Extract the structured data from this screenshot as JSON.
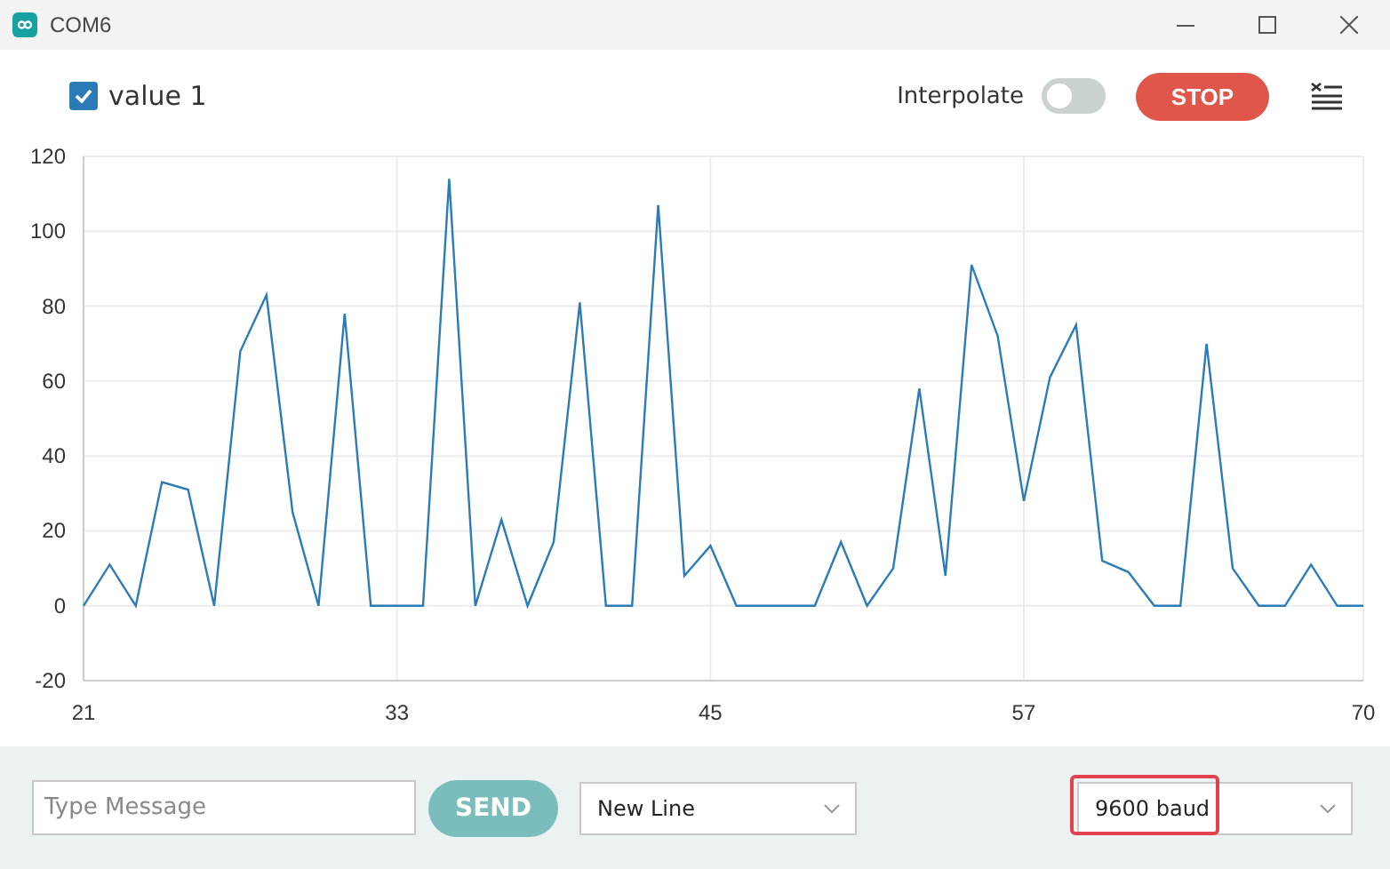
{
  "window": {
    "title": "COM6"
  },
  "toolbar": {
    "legend": [
      {
        "checked": true
      }
    ],
    "interpolate": {
      "label": "Interpolate",
      "on": false
    },
    "stop_button": "STOP"
  },
  "chart_data": {
    "type": "line",
    "x": [
      21,
      22,
      23,
      24,
      25,
      26,
      27,
      28,
      29,
      30,
      31,
      32,
      33,
      34,
      35,
      36,
      37,
      38,
      39,
      40,
      41,
      42,
      43,
      44,
      45,
      46,
      47,
      48,
      49,
      50,
      51,
      52,
      53,
      54,
      55,
      56,
      57,
      58,
      59,
      60,
      61,
      62,
      63,
      64,
      65,
      66,
      67,
      68,
      69,
      70
    ],
    "series": [
      {
        "name": "value 1",
        "color": "#2b7bb9",
        "values": [
          0,
          11,
          0,
          33,
          31,
          0,
          68,
          83,
          25,
          0,
          78,
          0,
          0,
          0,
          114,
          0,
          23,
          0,
          17,
          81,
          0,
          0,
          107,
          8,
          16,
          0,
          0,
          0,
          0,
          17,
          0,
          10,
          58,
          8,
          91,
          72,
          28,
          61,
          75,
          12,
          9,
          0,
          0,
          70,
          10,
          0,
          0,
          11,
          0,
          0
        ]
      }
    ],
    "grid": true,
    "xlim": [
      21,
      70
    ],
    "ylim": [
      -20,
      120
    ],
    "xticks": [
      21,
      33,
      45,
      57,
      70
    ],
    "yticks": [
      -20,
      0,
      20,
      40,
      60,
      80,
      100,
      120
    ]
  },
  "footer": {
    "message": {
      "placeholder": "Type Message"
    },
    "send_button": {
      "label": "SEND",
      "disabled": true
    },
    "line_ending": {
      "value": "New Line"
    },
    "baud": {
      "value": "9600 baud",
      "highlighted": true
    }
  }
}
